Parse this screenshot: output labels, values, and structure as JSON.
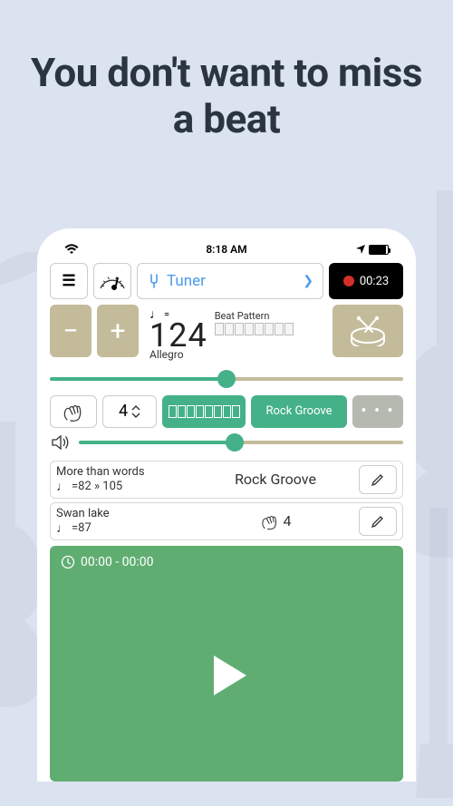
{
  "headline": "You don't want to miss a beat",
  "statusbar": {
    "time": "8:18 AM"
  },
  "topbar": {
    "menu_glyph": "☰",
    "tuner_label": "Tuner",
    "rec_time": "00:23"
  },
  "tempo": {
    "minus": "−",
    "plus": "+",
    "note_eq": "=",
    "bpm": "124",
    "name": "Allegro",
    "pattern_label": "Beat Pattern"
  },
  "controls": {
    "timesig_num": "4",
    "groove_label": "Rock Groove",
    "more_glyph": "• • •"
  },
  "slider1_pct": "50%",
  "slider2_pct": "48%",
  "songs": [
    {
      "title": "More than words",
      "tempo": "=82 » 105",
      "mid": "Rock Groove",
      "mid_type": "text"
    },
    {
      "title": "Swan lake",
      "tempo": "=87",
      "mid": "4",
      "mid_type": "hand"
    }
  ],
  "player": {
    "time": "00:00 - 00:00"
  }
}
